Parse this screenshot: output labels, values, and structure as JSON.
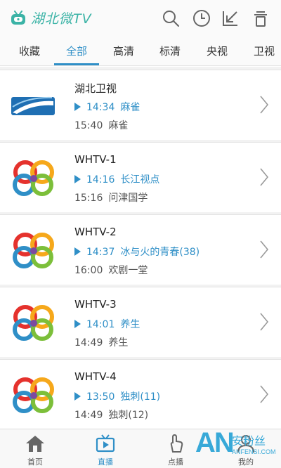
{
  "app": {
    "title": "湖北微TV",
    "brand_color": "#3bb3a6",
    "accent_color": "#2f8fc7"
  },
  "header": {
    "icons": [
      "search-icon",
      "history-clock-icon",
      "download-arrow-icon",
      "trash-icon"
    ]
  },
  "tabs": [
    {
      "label": "收藏",
      "active": false
    },
    {
      "label": "全部",
      "active": true
    },
    {
      "label": "高清",
      "active": false
    },
    {
      "label": "标清",
      "active": false
    },
    {
      "label": "央视",
      "active": false
    },
    {
      "label": "卫视",
      "active": false
    }
  ],
  "channels": [
    {
      "name": "湖北卫视",
      "logo": "hubei-satellite-logo",
      "now_time": "14:34",
      "now_title": "麻雀",
      "next_time": "15:40",
      "next_title": "麻雀"
    },
    {
      "name": "WHTV-1",
      "logo": "whtv-flower-logo",
      "now_time": "14:16",
      "now_title": "长江视点",
      "next_time": "15:16",
      "next_title": "问津国学"
    },
    {
      "name": "WHTV-2",
      "logo": "whtv-flower-logo",
      "now_time": "14:37",
      "now_title": "冰与火的青春(38)",
      "next_time": "16:00",
      "next_title": "欢剧一堂"
    },
    {
      "name": "WHTV-3",
      "logo": "whtv-flower-logo",
      "now_time": "14:01",
      "now_title": "养生",
      "next_time": "14:49",
      "next_title": "养生"
    },
    {
      "name": "WHTV-4",
      "logo": "whtv-flower-logo",
      "now_time": "13:50",
      "now_title": "独刺(11)",
      "next_time": "14:49",
      "next_title": "独刺(12)"
    }
  ],
  "bottom_nav": [
    {
      "label": "首页",
      "icon": "home-icon",
      "active": false
    },
    {
      "label": "直播",
      "icon": "live-tv-icon",
      "active": true
    },
    {
      "label": "点播",
      "icon": "hand-tap-icon",
      "active": false
    },
    {
      "label": "我的",
      "icon": "user-icon",
      "active": false
    }
  ],
  "watermark": {
    "logo": "AN",
    "cn": "安粉丝",
    "url": "ANFENSI.COM"
  }
}
